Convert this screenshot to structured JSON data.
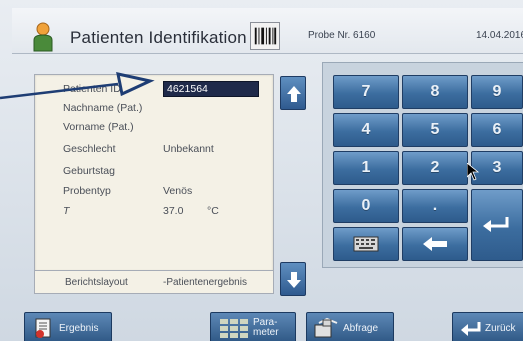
{
  "header": {
    "title": "Patienten Identifikation",
    "sample_number": "Probe Nr. 6160",
    "date": "14.04.2016",
    "icons": [
      "person-icon",
      "barcode-icon"
    ]
  },
  "patient": {
    "fields": [
      {
        "label": "Patienten ID",
        "value": "4621564",
        "selected": true
      },
      {
        "label": "Nachname (Pat.)",
        "value": ""
      },
      {
        "label": "Vorname (Pat.)",
        "value": ""
      },
      {
        "label": "Geschlecht",
        "value": "Unbekannt"
      },
      {
        "label": "Geburtstag",
        "value": ""
      },
      {
        "label": "Probentyp",
        "value": "Venös"
      },
      {
        "label": "T",
        "value": "37.0",
        "unit": "°C"
      }
    ],
    "report_layout": {
      "label": "Berichtslayout",
      "value": "-Patientenergebnis"
    }
  },
  "keypad": {
    "keys": [
      "7",
      "8",
      "9",
      "4",
      "5",
      "6",
      "1",
      "2",
      "3",
      "0",
      "."
    ],
    "icons": [
      "keyboard-icon",
      "backspace-icon",
      "enter-icon"
    ]
  },
  "bottom_bar": {
    "result_label": "Ergebnis",
    "parameter_label": "Para-\nmeter",
    "query_label": "Abfrage",
    "back_label": "Zurück"
  },
  "colors": {
    "key_blue": "#3c6d9f",
    "panel_bg": "#f4f1e6",
    "selection": "#1f2a4a"
  }
}
